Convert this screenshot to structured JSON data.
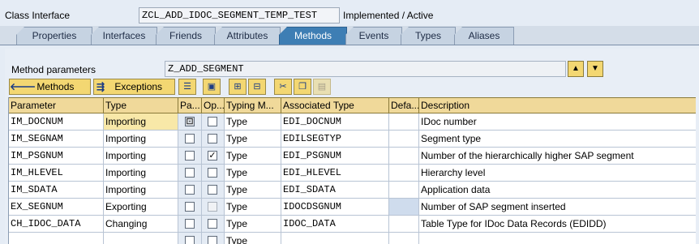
{
  "header": {
    "label": "Class Interface",
    "class_name": "ZCL_ADD_IDOC_SEGMENT_TEMP_TEST",
    "status": "Implemented / Active"
  },
  "tabs": [
    {
      "label": "Properties",
      "active": false
    },
    {
      "label": "Interfaces",
      "active": false
    },
    {
      "label": "Friends",
      "active": false
    },
    {
      "label": "Attributes",
      "active": false
    },
    {
      "label": "Methods",
      "active": true
    },
    {
      "label": "Events",
      "active": false
    },
    {
      "label": "Types",
      "active": false
    },
    {
      "label": "Aliases",
      "active": false
    }
  ],
  "method": {
    "label": "Method parameters",
    "value": "Z_ADD_SEGMENT"
  },
  "toolbar": {
    "methods_label": "Methods",
    "exceptions_label": "Exceptions"
  },
  "table": {
    "columns": [
      "Parameter",
      "Type",
      "Pa...",
      "Op...",
      "Typing M...",
      "Associated Type",
      "Defa...",
      "Description"
    ],
    "rows": [
      {
        "parameter": "IM_DOCNUM",
        "type": "Importing",
        "pass": false,
        "optional": false,
        "typing": "Type",
        "assoc": "EDI_DOCNUM",
        "default": "",
        "description": "IDoc number"
      },
      {
        "parameter": "IM_SEGNAM",
        "type": "Importing",
        "pass": false,
        "optional": false,
        "typing": "Type",
        "assoc": "EDILSEGTYP",
        "default": "",
        "description": "Segment type"
      },
      {
        "parameter": "IM_PSGNUM",
        "type": "Importing",
        "pass": false,
        "optional": true,
        "typing": "Type",
        "assoc": "EDI_PSGNUM",
        "default": "",
        "description": "Number of the hierarchically higher SAP segment"
      },
      {
        "parameter": "IM_HLEVEL",
        "type": "Importing",
        "pass": false,
        "optional": false,
        "typing": "Type",
        "assoc": "EDI_HLEVEL",
        "default": "",
        "description": "Hierarchy level"
      },
      {
        "parameter": "IM_SDATA",
        "type": "Importing",
        "pass": false,
        "optional": false,
        "typing": "Type",
        "assoc": "EDI_SDATA",
        "default": "",
        "description": "Application data"
      },
      {
        "parameter": "EX_SEGNUM",
        "type": "Exporting",
        "pass": false,
        "optional": false,
        "typing": "Type",
        "assoc": "IDOCDSGNUM",
        "default": "",
        "description": "Number of SAP segment inserted"
      },
      {
        "parameter": "CH_IDOC_DATA",
        "type": "Changing",
        "pass": false,
        "optional": false,
        "typing": "Type",
        "assoc": "IDOC_DATA",
        "default": "",
        "description": "Table Type for IDoc Data Records (EDIDD)"
      },
      {
        "parameter": "",
        "type": "",
        "pass": false,
        "optional": false,
        "typing": "Type",
        "assoc": "",
        "default": "",
        "description": ""
      }
    ]
  },
  "colors": {
    "active_tab": "#3e7eb4",
    "button_yellow": "#f3d772",
    "header_row": "#f0d99a"
  }
}
